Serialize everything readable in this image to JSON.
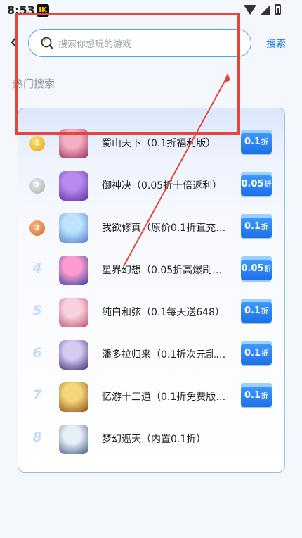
{
  "status_bar": {
    "time": "8:53",
    "app_badge": "IK"
  },
  "search": {
    "placeholder": "搜索你想玩的游戏",
    "button_label": "搜索"
  },
  "section_title": "热门搜索",
  "hot_list": [
    {
      "rank": "1",
      "name": "蜀山天下（0.1折福利版）",
      "discount": "0.1",
      "icon_colors": [
        "#f3b0c4",
        "#9b2a52"
      ]
    },
    {
      "rank": "2",
      "name": "御神决（0.05折十倍返利）",
      "discount": "0.05",
      "icon_colors": [
        "#b88af0",
        "#5a2fa8"
      ]
    },
    {
      "rank": "3",
      "name": "我欲修真（原价0.1折直充…",
      "discount": "0.1",
      "icon_colors": [
        "#bfe4ff",
        "#4b78c9"
      ]
    },
    {
      "rank": "4",
      "name": "星界幻想（0.05折高爆刷…",
      "discount": "0.05",
      "icon_colors": [
        "#ff9bd0",
        "#2b3f9c"
      ]
    },
    {
      "rank": "5",
      "name": "纯白和弦（0.1每天送648）",
      "discount": "0.1",
      "icon_colors": [
        "#f7d2dc",
        "#c04a6a"
      ]
    },
    {
      "rank": "6",
      "name": "潘多拉归来（0.1折次元乱…",
      "discount": "0.1",
      "icon_colors": [
        "#d7c9f0",
        "#3c2f73"
      ]
    },
    {
      "rank": "7",
      "name": "忆游十三道（0.1折免费版…",
      "discount": "0.1",
      "icon_colors": [
        "#f5d67a",
        "#8a4a12"
      ]
    },
    {
      "rank": "8",
      "name": "梦幻遮天（内置0.1折）",
      "discount": "",
      "icon_colors": [
        "#e6eef8",
        "#3a5a80"
      ]
    }
  ],
  "colors": {
    "accent": "#1a78e6",
    "annotation": "#e4463a"
  }
}
